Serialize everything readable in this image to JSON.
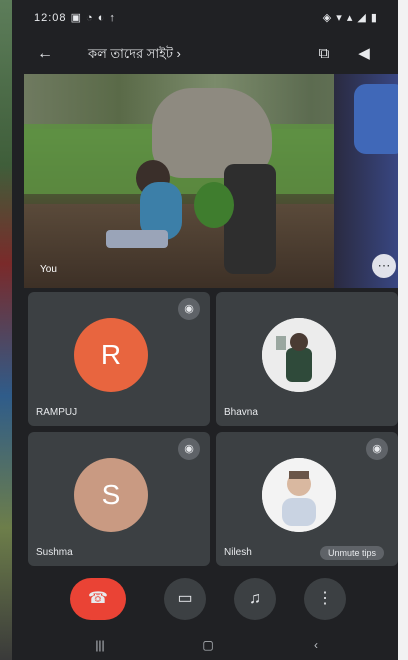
{
  "status_bar": {
    "time": "12:08 ▣ ◔ ◐ ↑",
    "right": "◈ ▾ ▴ ◢ ▮"
  },
  "topbar": {
    "meeting_title": "কল তাদের সাইট ›"
  },
  "main_video": {
    "name": "You"
  },
  "participants": [
    {
      "initial": "R",
      "name": "RAMPUJ",
      "avatar_color": "#e8653f"
    },
    {
      "initial": "",
      "name": "Bhavna",
      "avatar_color": "#e6e6e6"
    },
    {
      "initial": "S",
      "name": "Sushma",
      "avatar_color": "#c99a82"
    },
    {
      "initial": "",
      "name": "Nilesh",
      "avatar_color": "#f0f0f0",
      "chip": "Unmute tips"
    }
  ],
  "colors": {
    "end_call": "#ea4335",
    "tile": "#3c4043",
    "background": "#202124"
  }
}
